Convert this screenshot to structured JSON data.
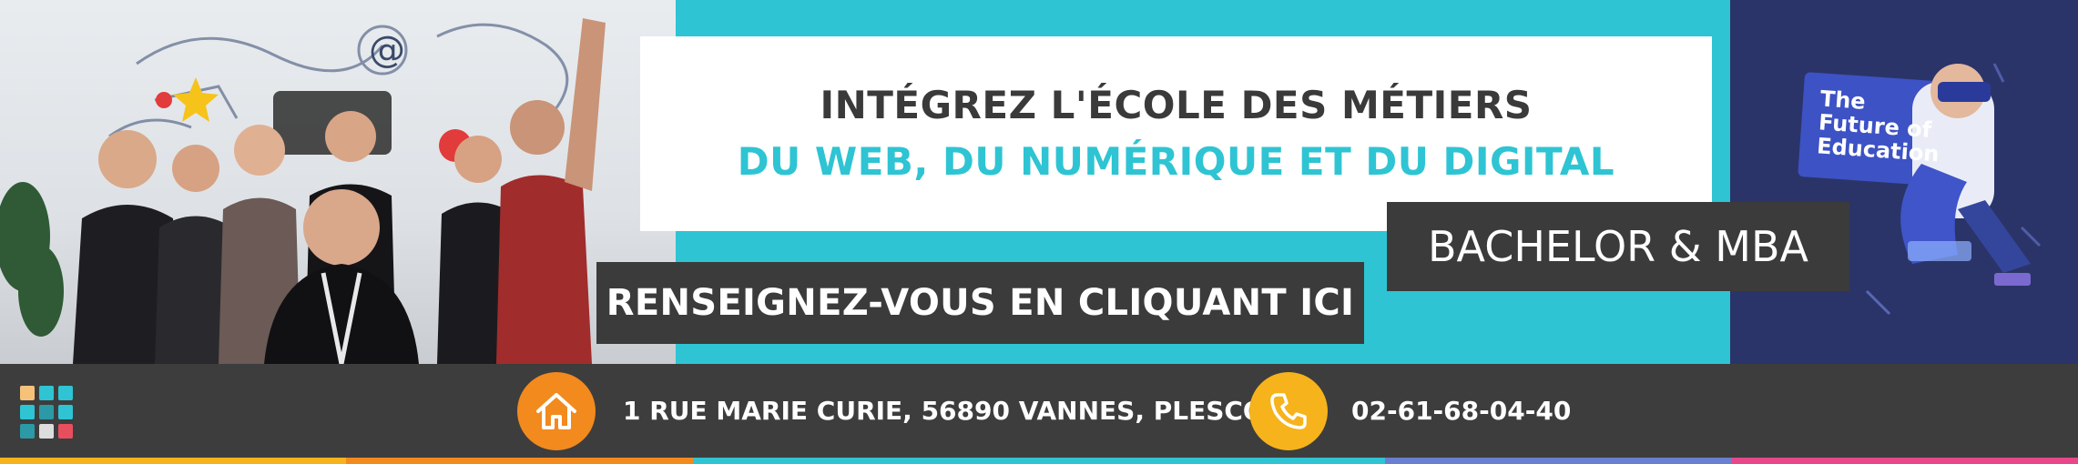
{
  "theme": {
    "teal": "#2ec4d3",
    "navy": "#2b3468",
    "dark_box": "#3b3b3b",
    "footer_bg": "#3d3d3d",
    "home_icon_bg": "#f28a1e",
    "phone_icon_bg": "#f6b31b"
  },
  "headline": {
    "line1": "INTÉGREZ L'ÉCOLE DES MÉTIERS",
    "line2": "DU WEB, DU NUMÉRIQUE ET DU DIGITAL"
  },
  "programs": {
    "label": "BACHELOR & MBA"
  },
  "cta": {
    "label": "RENSEIGNEZ-VOUS EN CLIQUANT ICI"
  },
  "illustration": {
    "screen_text_line1": "The",
    "screen_text_line2": "Future of",
    "screen_text_line3": "Education"
  },
  "footer": {
    "address": "1 RUE MARIE CURIE, 56890 VANNES, PLESCOP",
    "phone": "02-61-68-04-40",
    "home_icon": "home-icon",
    "phone_icon": "phone-icon",
    "logo_colors": [
      "#f6c27a",
      "#2ec4d3",
      "#2ec4d3",
      "#2ec4d3",
      "#2b9aa6",
      "#2ec4d3",
      "#2b9aa6",
      "#dddddd",
      "#e84f5e"
    ]
  },
  "stripe_colors": [
    "#f6b31b",
    "#f28a1e",
    "#2ec4d3",
    "#2ec4d3",
    "#6a7fd0",
    "#e8488a"
  ]
}
